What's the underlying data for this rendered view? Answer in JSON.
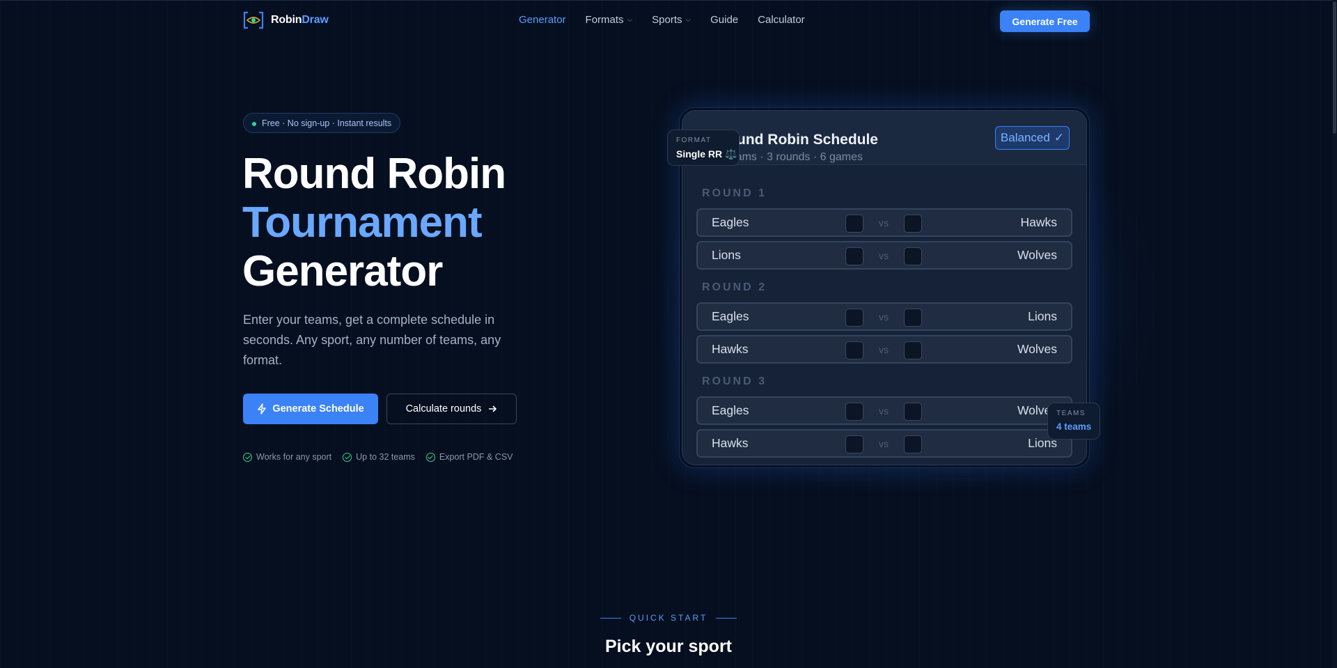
{
  "brand": {
    "name_a": "Robin",
    "name_b": "Draw"
  },
  "nav": {
    "items": [
      {
        "label": "Generator",
        "active": true,
        "dropdown": false
      },
      {
        "label": "Formats",
        "active": false,
        "dropdown": true
      },
      {
        "label": "Sports",
        "active": false,
        "dropdown": true
      },
      {
        "label": "Guide",
        "active": false,
        "dropdown": false
      },
      {
        "label": "Calculator",
        "active": false,
        "dropdown": false
      }
    ],
    "cta": "Generate Free"
  },
  "hero": {
    "badge": "Free · No sign-up · Instant results",
    "title_line1": "Round Robin",
    "title_line2": "Tournament",
    "title_line3": "Generator",
    "lead": "Enter your teams, get a complete schedule in seconds. Any sport, any number of teams, any format.",
    "primary_button": "Generate Schedule",
    "secondary_button": "Calculate rounds",
    "features": [
      "Works for any sport",
      "Up to 32 teams",
      "Export PDF & CSV"
    ]
  },
  "preview": {
    "title": "Round Robin Schedule",
    "subtitle": "4 teams · 3 rounds · 6 games",
    "status": "Balanced",
    "vs_label": "vs",
    "rounds": [
      {
        "label": "ROUND 1",
        "matches": [
          {
            "home": "Eagles",
            "away": "Hawks"
          },
          {
            "home": "Lions",
            "away": "Wolves"
          }
        ]
      },
      {
        "label": "ROUND 2",
        "matches": [
          {
            "home": "Eagles",
            "away": "Lions"
          },
          {
            "home": "Hawks",
            "away": "Wolves"
          }
        ]
      },
      {
        "label": "ROUND 3",
        "matches": [
          {
            "home": "Eagles",
            "away": "Wolves"
          },
          {
            "home": "Hawks",
            "away": "Lions"
          }
        ]
      }
    ],
    "format_chip": {
      "label": "FORMAT",
      "value": "Single RR ⚖️"
    },
    "teams_chip": {
      "label": "TEAMS",
      "value": "4 teams"
    }
  },
  "quick_start": {
    "eyebrow": "QUICK START",
    "heading": "Pick your sport"
  },
  "colors": {
    "accent": "#3b82f6",
    "accent_light": "#5b9dff",
    "background": "#060f1f",
    "success": "#34d399"
  }
}
